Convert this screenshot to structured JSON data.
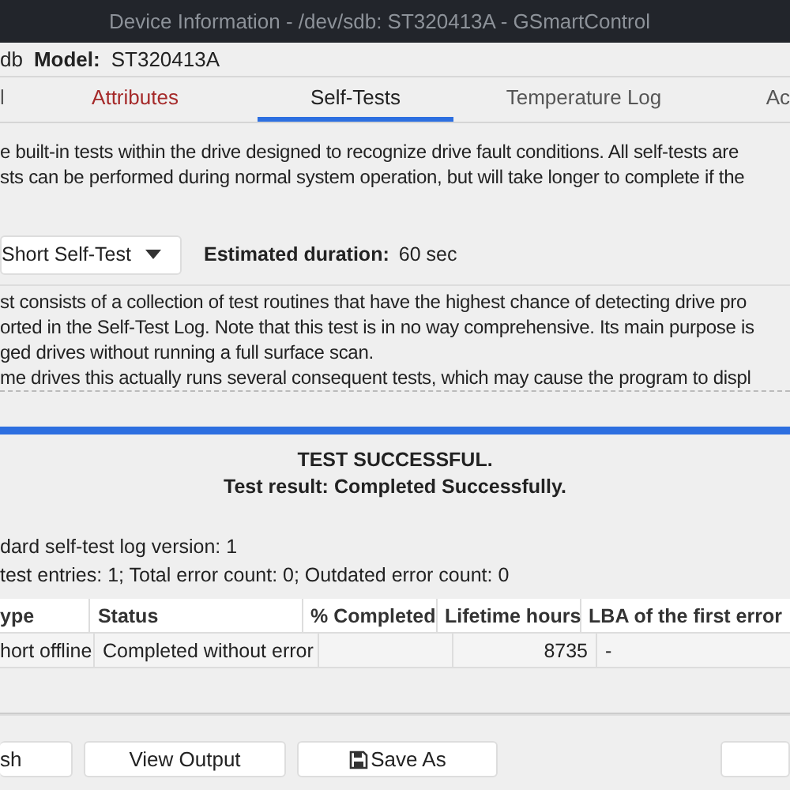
{
  "window": {
    "title": "Device Information - /dev/sdb: ST320413A - GSmartControl"
  },
  "header": {
    "device": "db",
    "model_label": "Model:",
    "model": "ST320413A"
  },
  "tabs": [
    {
      "label": "l",
      "selected": false,
      "warning": false
    },
    {
      "label": "Attributes",
      "selected": false,
      "warning": true
    },
    {
      "label": "Self-Tests",
      "selected": true,
      "warning": false
    },
    {
      "label": "Temperature Log",
      "selected": false,
      "warning": false
    },
    {
      "label": "Ac",
      "selected": false,
      "warning": false
    }
  ],
  "intro": [
    "e built-in tests within the drive designed to recognize drive fault conditions. All self-tests are",
    "sts can be performed during normal system operation, but will take longer to complete if the"
  ],
  "test_select": {
    "value": "Short Self-Test",
    "duration_label": "Estimated duration:",
    "duration": "60 sec"
  },
  "test_description": [
    "st consists of a collection of test routines that have the highest chance of detecting drive pro",
    "orted in the Self-Test Log. Note that this test is in no way comprehensive. Its main purpose is",
    "ged drives without running a full surface scan.",
    "me drives this actually runs several consequent tests, which may cause the program to displ"
  ],
  "progress": {
    "level": 1
  },
  "result": {
    "title": "TEST SUCCESSFUL.",
    "message": "Test result: Completed Successfully."
  },
  "log_info": [
    "dard self-test log version: 1",
    "test entries: 1; Total error count: 0; Outdated error count: 0"
  ],
  "table": {
    "columns": [
      "ype",
      "Status",
      "% Completed",
      "Lifetime hours",
      "LBA of the first error"
    ],
    "rows": [
      {
        "type": "hort offline",
        "status": "Completed without error",
        "lifetime_hours": "8735",
        "lba": "-"
      }
    ]
  },
  "buttons": [
    {
      "label": "sh",
      "kind": "text"
    },
    {
      "label": "View Output",
      "kind": "text"
    },
    {
      "label": "Save As",
      "kind": "save"
    },
    {
      "kind": "blank"
    }
  ]
}
